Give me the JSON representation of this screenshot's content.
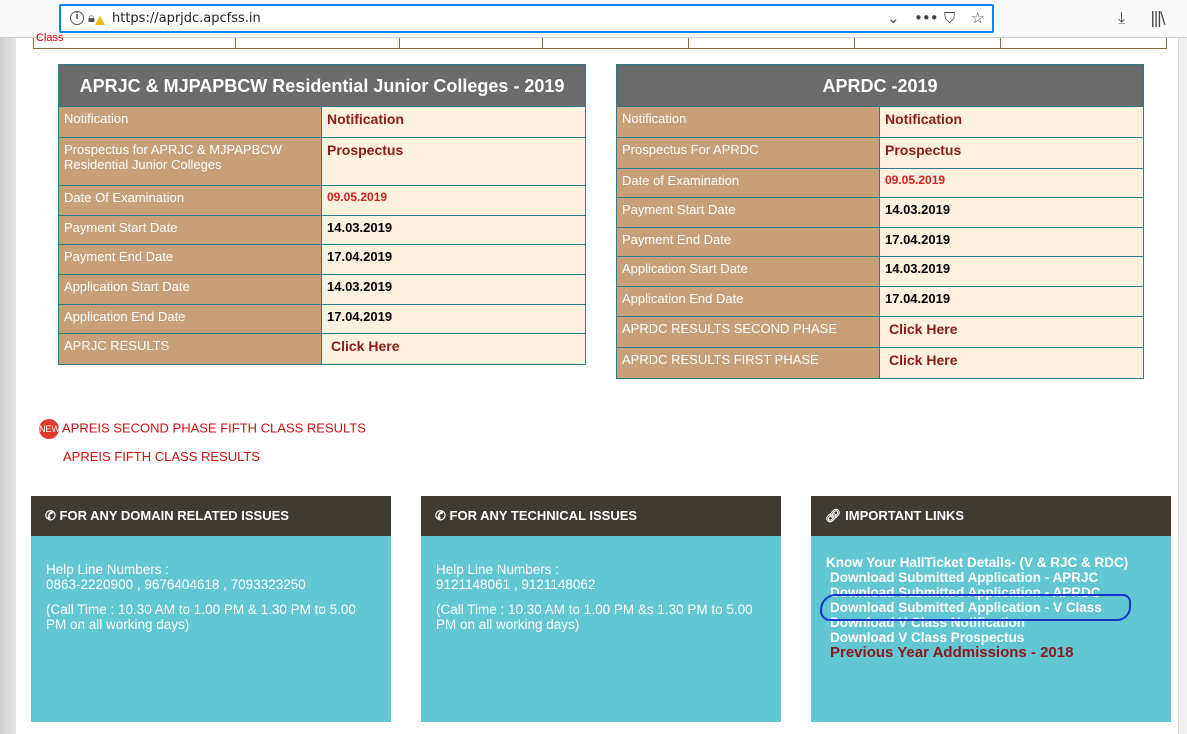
{
  "browser": {
    "url": "https://aprjdc.apcfss.in",
    "info_icon": "info-icon",
    "lock_icon": "lock-warning-icon",
    "icons": [
      "chevron-down-icon",
      "more-icon",
      "pocket-icon",
      "star-icon",
      "download-icon",
      "library-icon"
    ]
  },
  "top_fragment": "Class",
  "aprjc": {
    "title": "APRJC & MJPAPBCW Residential Junior Colleges - 2019",
    "rows": [
      {
        "label": "Notification",
        "value": "Notification"
      },
      {
        "label": "Prospectus for APRJC & MJPAPBCW Residential Junior Colleges",
        "value": "Prospectus"
      },
      {
        "label": "Date Of Examination",
        "value": "09.05.2019"
      },
      {
        "label": "Payment Start Date",
        "value": "14.03.2019"
      },
      {
        "label": "Payment End Date",
        "value": "17.04.2019"
      },
      {
        "label": "Application Start Date",
        "value": "14.03.2019"
      },
      {
        "label": "Application End Date",
        "value": "17.04.2019"
      },
      {
        "label": "APRJC RESULTS",
        "value": "Click Here"
      }
    ]
  },
  "aprdc": {
    "title": "APRDC -2019",
    "rows": [
      {
        "label": "Notification",
        "value": "Notification"
      },
      {
        "label": "Prospectus For APRDC",
        "value": "Prospectus"
      },
      {
        "label": "Date of Examination",
        "value": "09.05.2019"
      },
      {
        "label": "Payment Start Date",
        "value": "14.03.2019"
      },
      {
        "label": "Payment End Date",
        "value": "17.04.2019"
      },
      {
        "label": "Application Start Date",
        "value": "14.03.2019"
      },
      {
        "label": "Application End Date",
        "value": "17.04.2019"
      },
      {
        "label": "APRDC RESULTS SECOND PHASE",
        "value": "Click Here"
      },
      {
        "label": "APRDC RESULTS FIRST PHASE",
        "value": "Click Here"
      }
    ]
  },
  "results": {
    "badge": "NEW",
    "second_phase": "APREIS SECOND PHASE FIFTH CLASS RESULTS",
    "fifth_class": "APREIS FIFTH CLASS RESULTS"
  },
  "domain_box": {
    "title": "FOR ANY DOMAIN RELATED ISSUES",
    "helpline_label": "Help Line Numbers :",
    "numbers": "0863-2220900 , 9676404618 , 7093323250",
    "call_time": "(Call Time : 10.30 AM to 1.00 PM & 1.30 PM to 5.00 PM on all working days)"
  },
  "tech_box": {
    "title": "FOR ANY TECHNICAL ISSUES",
    "helpline_label": "Help Line Numbers :",
    "numbers": "9121148061 , 9121148062",
    "call_time": "(Call Time : 10.30 AM to 1.00 PM &s 1.30 PM to 5.00 PM on all working days)"
  },
  "links_box": {
    "title": "IMPORTANT LINKS",
    "items": [
      "Know Your HallTicket Details- (V & RJC & RDC)",
      "Download Submitted Application - APRJC",
      "Download Submitted Application - APRDC",
      "Download Submitted Application - V Class",
      "Download V Class Notification",
      "Download V Class Prospectus",
      "Previous Year Addmissions - 2018"
    ]
  },
  "colors": {
    "header_bg": "#6b6b6b",
    "label_bg": "#c7a07a",
    "cell_bg": "#fef1dd",
    "box_header": "#3f3a32",
    "box_body": "#62c7d3",
    "link_red": "#8b1a1a",
    "annotation": "#1636c9"
  }
}
